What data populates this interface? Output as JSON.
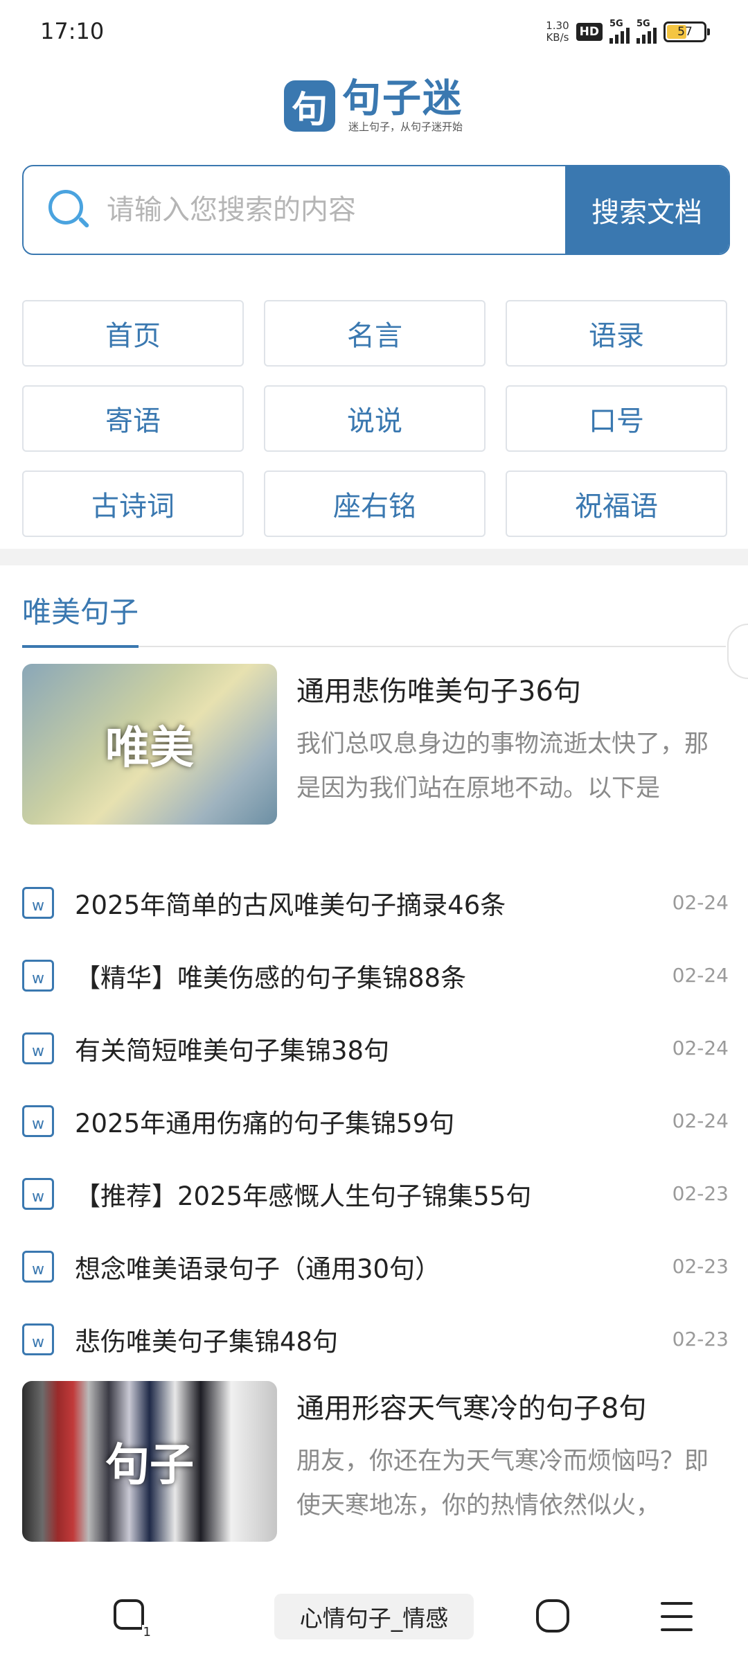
{
  "status": {
    "time": "17:10",
    "net_speed_value": "1.30",
    "net_speed_unit": "KB/s",
    "hd_badge": "HD",
    "signal1_label": "5G",
    "signal2_label": "5G",
    "battery_percent": "57",
    "battery_level": 0.57
  },
  "logo": {
    "mark": "句",
    "title": "句子迷",
    "slogan": "迷上句子，从句子迷开始"
  },
  "search": {
    "placeholder": "请输入您搜索的内容",
    "button_label": "搜索文档"
  },
  "categories": [
    "首页",
    "名言",
    "语录",
    "寄语",
    "说说",
    "口号",
    "古诗词",
    "座右铭",
    "祝福语"
  ],
  "section": {
    "title": "唯美句子"
  },
  "featured": [
    {
      "image_text": "唯美",
      "title": "通用悲伤唯美句子36句",
      "desc": "我们总叹息身边的事物流逝太快了，那是因为我们站在原地不动。以下是"
    },
    {
      "image_text": "句子",
      "title": "通用形容天气寒冷的句子8句",
      "desc": "朋友，你还在为天气寒冷而烦恼吗？即使天寒地冻，你的热情依然似火，"
    }
  ],
  "articles": [
    {
      "title": "2025年简单的古风唯美句子摘录46条",
      "date": "02-24"
    },
    {
      "title": "【精华】唯美伤感的句子集锦88条",
      "date": "02-24"
    },
    {
      "title": "有关简短唯美句子集锦38句",
      "date": "02-24"
    },
    {
      "title": "2025年通用伤痛的句子集锦59句",
      "date": "02-24"
    },
    {
      "title": "【推荐】2025年感慨人生句子锦集55句",
      "date": "02-23"
    },
    {
      "title": "想念唯美语录句子（通用30句）",
      "date": "02-23"
    },
    {
      "title": "悲伤唯美句子集锦48句",
      "date": "02-23"
    }
  ],
  "doc_icon_letter": "w",
  "bottom_nav": {
    "tab_count": "1",
    "page_title": "心情句子_情感"
  },
  "colors": {
    "accent": "#3a78b0",
    "search_icon": "#4aa3df",
    "muted_text": "#8a8a8a"
  },
  "icons": {
    "tabs": "tabs-icon",
    "home": "home-icon",
    "menu": "menu-icon",
    "search": "search-icon",
    "document": "document-icon"
  }
}
